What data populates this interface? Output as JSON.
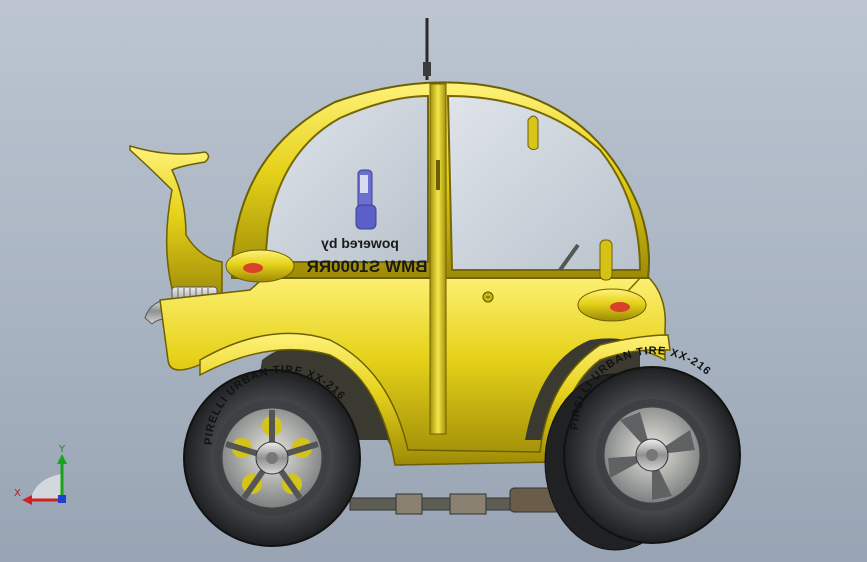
{
  "model": {
    "decal_line1": "powered by",
    "decal_line2": "BMW S1000RR",
    "tire_text": "PIRELLI URBAN TIRE XX-216"
  },
  "triad": {
    "x_label": "X",
    "y_label": "Y"
  },
  "colors": {
    "body_yellow": "#e6d21a",
    "body_dark": "#8a7a06",
    "tire": "#2c2e30",
    "background": "#aab4c2"
  }
}
